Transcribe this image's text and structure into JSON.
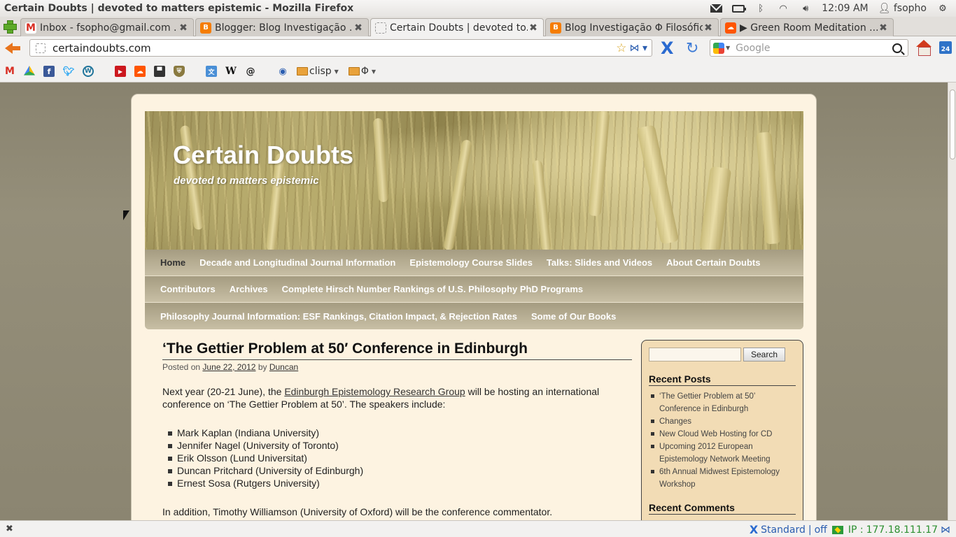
{
  "window": {
    "title": "Certain Doubts | devoted to matters epistemic - Mozilla Firefox",
    "clock": "12:09 AM",
    "user": "fsopho"
  },
  "tabs": [
    {
      "label": "Inbox - fsopho@gmail.com ...",
      "favicon": "gmail-icon",
      "color": "#d93025"
    },
    {
      "label": "Blogger: Blog Investigação ...",
      "favicon": "blogger-icon",
      "color": "#f57d00"
    },
    {
      "label": "Certain Doubts | devoted to...",
      "favicon": "blank-page-icon",
      "color": "#ffffff"
    },
    {
      "label": "Blog Investigação Φ Filosófica",
      "favicon": "blogger-icon",
      "color": "#f57d00"
    },
    {
      "label": "▶ Green Room Meditation ...",
      "favicon": "soundcloud-icon",
      "color": "#ff5500"
    }
  ],
  "nav": {
    "url": "certaindoubts.com",
    "search_placeholder": "Google",
    "calendar_day": "24"
  },
  "bookmarks": {
    "folders": [
      {
        "label": "clisp"
      },
      {
        "label": "Φ"
      }
    ]
  },
  "site": {
    "title": "Certain Doubts",
    "description": "devoted to matters epistemic"
  },
  "menu": {
    "rows": [
      [
        "Home",
        "Decade and Longitudinal Journal Information",
        "Epistemology Course Slides",
        "Talks: Slides and Videos",
        "About Certain Doubts"
      ],
      [
        "Contributors",
        "Archives",
        "Complete Hirsch Number Rankings of U.S. Philosophy PhD Programs"
      ],
      [
        "Philosophy Journal Information: ESF Rankings, Citation Impact, & Rejection Rates",
        "Some of Our Books"
      ]
    ]
  },
  "post": {
    "title": "‘The Gettier Problem at 50′ Conference in Edinburgh",
    "posted_on": "Posted on",
    "date": "June 22, 2012",
    "by": "by",
    "author": "Duncan",
    "intro_before": "Next year (20-21 June), the ",
    "intro_link": "Edinburgh Epistemology Research Group",
    "intro_after": " will be hosting an international conference on ‘The Gettier Problem at 50’. The speakers include:",
    "speakers": [
      "Mark Kaplan (Indiana University)",
      "Jennifer Nagel (University of Toronto)",
      "Erik Olsson (Lund Universitat)",
      "Duncan Pritchard (University of Edinburgh)",
      "Ernest Sosa (Rutgers University)"
    ],
    "addition": "In addition, Timothy Williamson (University of Oxford) will be the conference commentator."
  },
  "sidebar": {
    "search_button": "Search",
    "recent_posts_title": "Recent Posts",
    "recent_posts": [
      "‘The Gettier Problem at 50’ Conference in Edinburgh",
      "Changes",
      "New Cloud Web Hosting for CD",
      "Upcoming 2012 European Epistemology Network Meeting",
      "6th Annual Midwest Epistemology Workshop"
    ],
    "recent_comments_title": "Recent Comments"
  },
  "statusbar": {
    "proxy_mode": "Standard",
    "proxy_sep": "|",
    "proxy_state": "off",
    "ip_label": "IP :",
    "ip": "177.18.111.17"
  }
}
